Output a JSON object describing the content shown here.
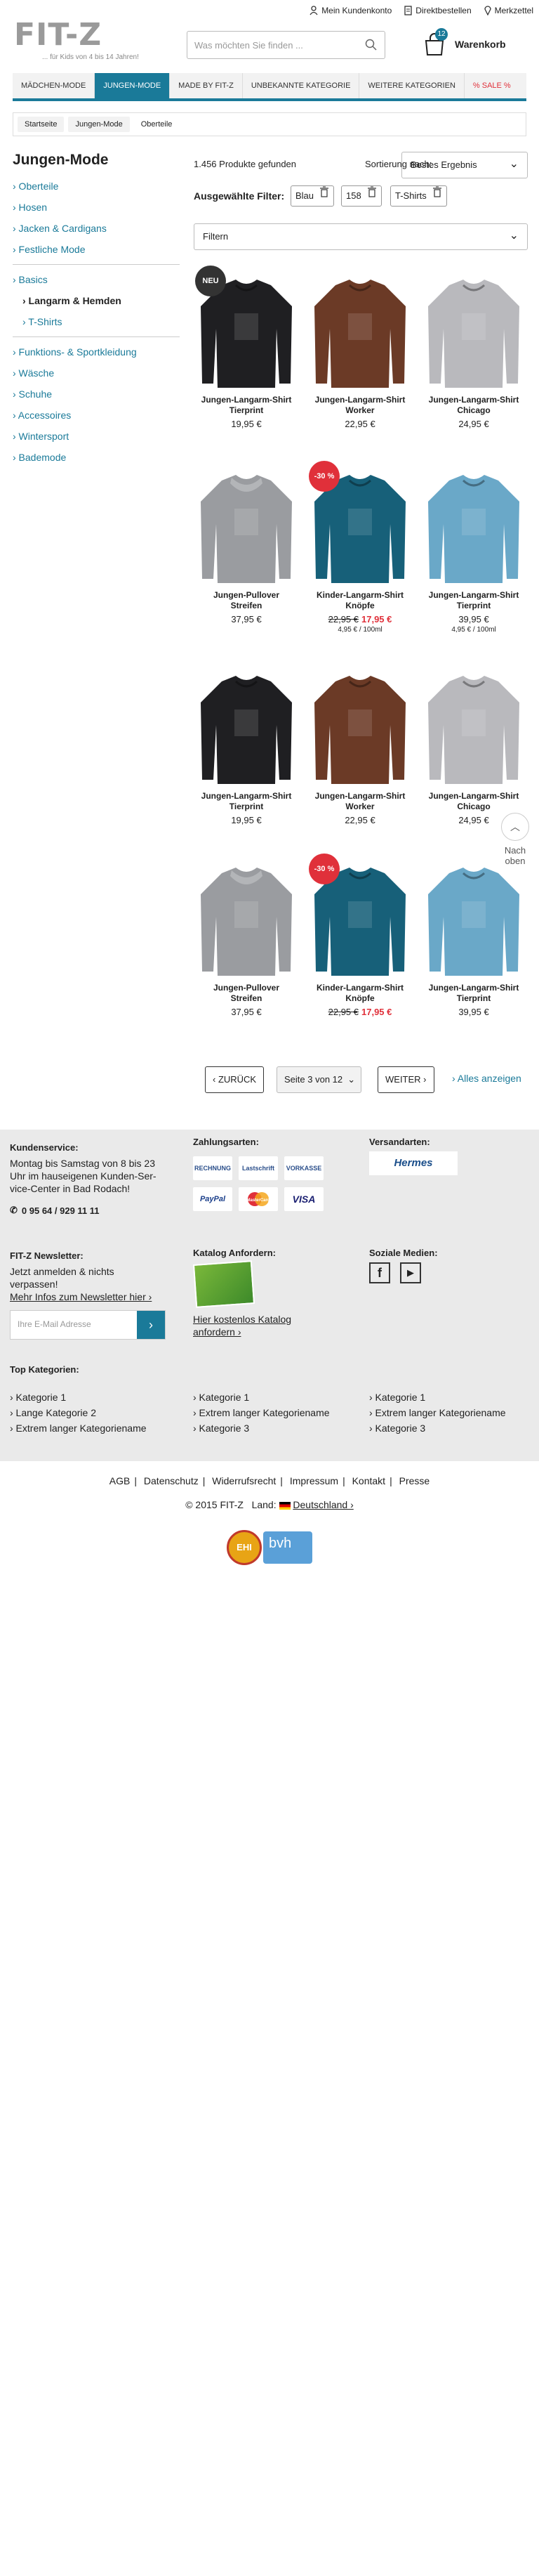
{
  "top_links": [
    "Mein Kundenkonto",
    "Direktbestellen",
    "Merkzettel"
  ],
  "logo": {
    "mark": "FIT-Z",
    "tagline": "... für Kids von 4 bis 14 Jahren!"
  },
  "search": {
    "placeholder": "Was möchten Sie finden ..."
  },
  "cart": {
    "count": "12",
    "label": "Warenkorb"
  },
  "nav": [
    "MÄDCHEN-MODE",
    "JUNGEN-MODE",
    "MADE BY FIT-Z",
    "UNBEKANNTE KATEGORIE",
    "WEITERE KATEGORIEN",
    "% SALE %"
  ],
  "breadcrumb": [
    "Startseite",
    "Jungen-Mode",
    "Oberteile"
  ],
  "sidebar": {
    "title": "Jungen-Mode",
    "items": [
      "› Oberteile",
      "› Hosen",
      "› Jacken & Cardigans",
      "› Festliche Mode",
      "› Basics",
      "› Langarm & Hemden",
      "› T-Shirts",
      "› Funktions- & Sportkleidung",
      "› Wäsche",
      "› Schuhe",
      "› Accessoires",
      "› Wintersport",
      "› Bademode"
    ]
  },
  "listing": {
    "count": "1.456 Produkte gefunden",
    "sort_label": "Sortierung nach:",
    "sort_value": "Bestes Ergebnis",
    "filter_label": "Ausgewählte Filter:",
    "chips": [
      "Blau",
      "158",
      "T-Shirts"
    ],
    "filter_select": "Filtern"
  },
  "products": [
    {
      "name1": "Jungen-Langarm-Shirt",
      "name2": "Tierprint",
      "price": "19,95 €",
      "flag": "NEU",
      "color": "#1f1f22"
    },
    {
      "name1": "Jungen-Langarm-Shirt",
      "name2": "Worker",
      "price": "22,95 €",
      "color": "#6b3a26"
    },
    {
      "name1": "Jungen-Langarm-Shirt",
      "name2": "Chicago",
      "price": "24,95 €",
      "color": "#b9b9bd"
    },
    {
      "name1": "Jungen-Pullover",
      "name2": "Streifen",
      "price": "37,95 €",
      "color": "#9a9ca0"
    },
    {
      "name1": "Kinder-Langarm-Shirt",
      "name2": "Knöpfe",
      "old": "22,95 €",
      "price": "17,95 €",
      "unit": "4,95 € / 100ml",
      "flag": "-30 %",
      "color": "#176079"
    },
    {
      "name1": "Jungen-Langarm-Shirt",
      "name2": "Tierprint",
      "price": "39,95 €",
      "unit": "4,95 € / 100ml",
      "color": "#6aa8c8"
    },
    {
      "name1": "Jungen-Langarm-Shirt",
      "name2": "Tierprint",
      "price": "19,95 €",
      "color": "#1f1f22"
    },
    {
      "name1": "Jungen-Langarm-Shirt",
      "name2": "Worker",
      "price": "22,95 €",
      "color": "#6b3a26"
    },
    {
      "name1": "Jungen-Langarm-Shirt",
      "name2": "Chicago",
      "price": "24,95 €",
      "color": "#b9b9bd"
    },
    {
      "name1": "Jungen-Pullover",
      "name2": "Streifen",
      "price": "37,95 €",
      "color": "#9a9ca0"
    },
    {
      "name1": "Kinder-Langarm-Shirt",
      "name2": "Knöpfe",
      "old": "22,95 €",
      "price": "17,95 €",
      "flag": "-30 %",
      "color": "#176079"
    },
    {
      "name1": "Jungen-Langarm-Shirt",
      "name2": "Tierprint",
      "price": "39,95 €",
      "color": "#6aa8c8"
    }
  ],
  "to_top": {
    "line1": "Nach",
    "line2": "oben"
  },
  "pagination": {
    "prev": "‹ ZURÜCK",
    "page": "Seite 3 von 12",
    "next": "WEITER ›",
    "all": "› Alles anzeigen"
  },
  "footer": {
    "service_title": "Kundenservice:",
    "service_text": "Montag bis Samstag von 8 bis 23 Uhr im hauseigenen Kunden-Ser-vice-Center in Bad Rodach!",
    "phone": "0 95 64 / 929 11 11",
    "payment_title": "Zahlungsarten:",
    "payment": [
      "RECHNUNG",
      "Lastschrift",
      "VORKASSE",
      "PayPal",
      "MasterCard",
      "VISA"
    ],
    "shipping_title": "Versandarten:",
    "shipping": "Hermes",
    "newsletter_title": "FIT-Z Newsletter:",
    "newsletter_text": "Jetzt anmelden & nichts verpassen!",
    "newsletter_link": "Mehr Infos zum Newsletter hier ›",
    "email_placeholder": "Ihre E-Mail Adresse",
    "catalog_title": "Katalog Anfordern:",
    "catalog_link": "Hier kostenlos Katalog anfordern ›",
    "social_title": "Soziale Medien:",
    "top_title": "Top Kategorien:",
    "cat1": [
      "› Kategorie 1",
      "› Lange Kategorie 2",
      "› Extrem langer Kategoriename"
    ],
    "cat2": [
      "› Kategorie 1",
      "› Extrem langer Kategoriename",
      "› Kategorie 3"
    ],
    "cat3": [
      "› Kategorie 1",
      "› Extrem langer Kategoriename",
      "› Kategorie 3"
    ]
  },
  "legal": [
    "AGB",
    "Datenschutz",
    "Widerrufsrecht",
    "Impressum",
    "Kontakt",
    "Presse"
  ],
  "copyright": "© 2015 FIT-Z",
  "country_label": "Land:",
  "country": "Deutschland ›",
  "seal": {
    "left": "EHI",
    "right": "bvh"
  }
}
